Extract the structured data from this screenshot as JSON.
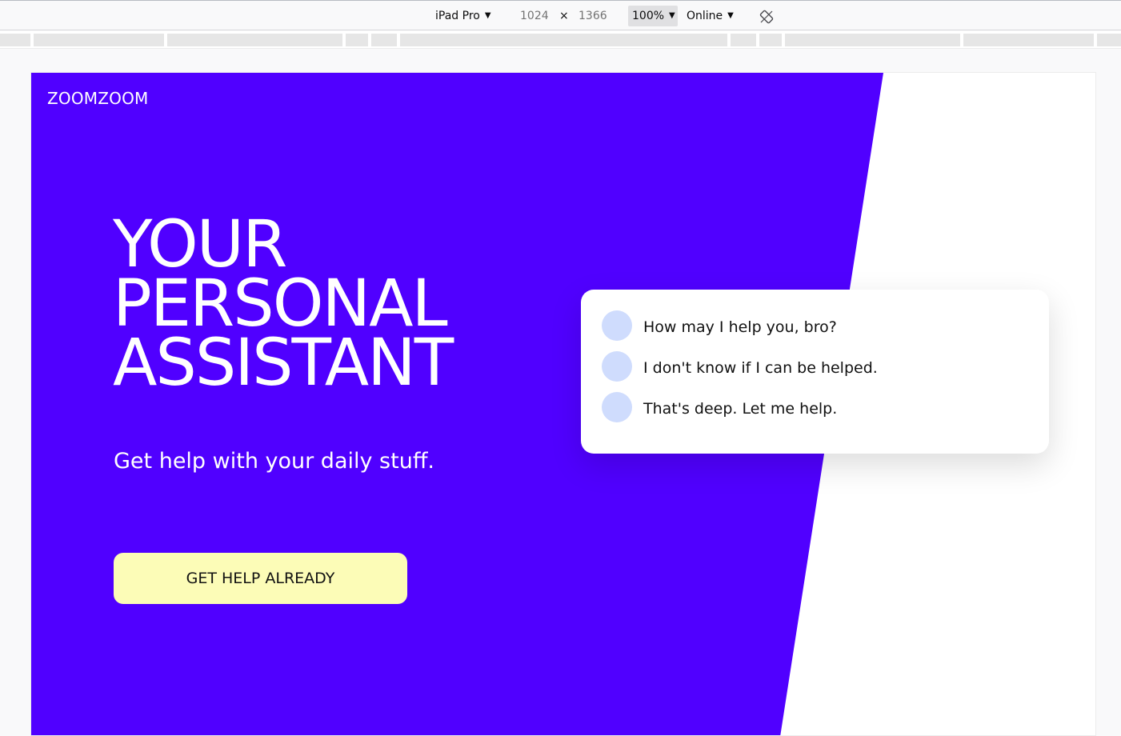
{
  "devtools": {
    "device": "iPad Pro",
    "width": "1024",
    "times": "×",
    "height": "1366",
    "zoom": "100%",
    "network": "Online",
    "dropdown_glyph": "▼",
    "rotate_icon": "rotate-icon"
  },
  "site": {
    "logo": "ZOOMZOOM",
    "headline": [
      "YOUR",
      "PERSONAL",
      "ASSISTANT"
    ],
    "subtitle": "Get help with your daily stuff.",
    "cta_label": "GET HELP ALREADY"
  },
  "chat": {
    "messages": [
      "How may I help you, bro?",
      "I don't know if I can be helped.",
      "That's deep. Let me help."
    ]
  },
  "colors": {
    "hero": "#5000ff",
    "cta": "#fcfcb7",
    "avatar": "#cfdcfd",
    "text_dark": "#111111"
  }
}
